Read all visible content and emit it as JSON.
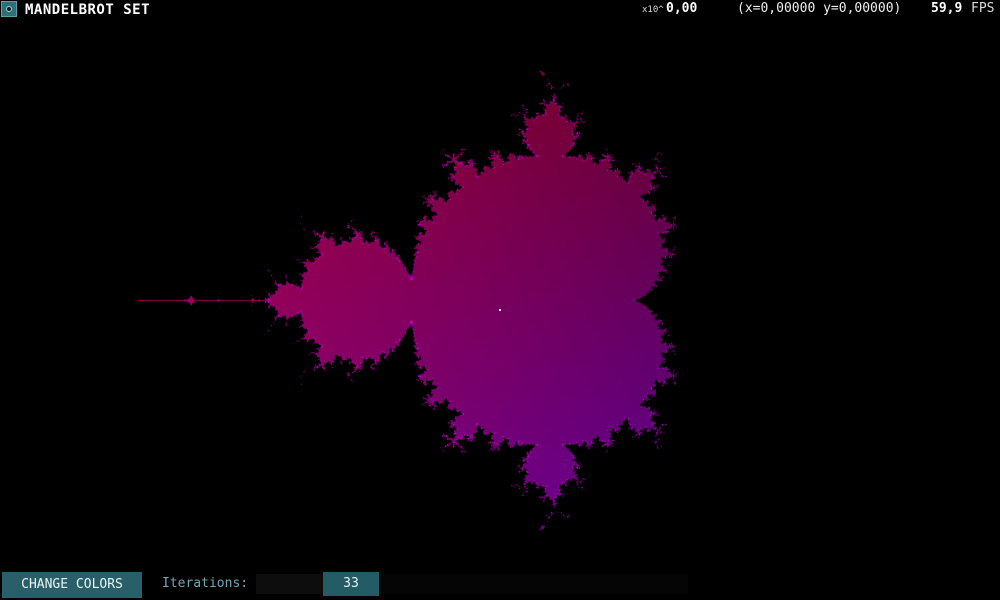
{
  "app": {
    "title": "MANDELBROT SET",
    "icon": "app-icon"
  },
  "status": {
    "zoom_prefix": "x10^",
    "zoom_value": "0,00",
    "coordinates": "(x=0,00000 y=0,00000)",
    "fps_value": "59,9",
    "fps_label": "FPS"
  },
  "controls": {
    "change_colors_label": "CHANGE COLORS",
    "iterations_label": "Iterations:",
    "iterations_value": "33",
    "iterations_fraction": 0.25
  },
  "render": {
    "max_iterations": 33,
    "colors": {
      "interior_top_left": "#c8003c",
      "interior_top_right": "#3c0008",
      "interior_bottom_left": "#a0006e",
      "interior_bottom_right": "#3a00c0",
      "edge": "#ff00ff",
      "background": "#000000",
      "accent": "#2a5f69"
    }
  }
}
